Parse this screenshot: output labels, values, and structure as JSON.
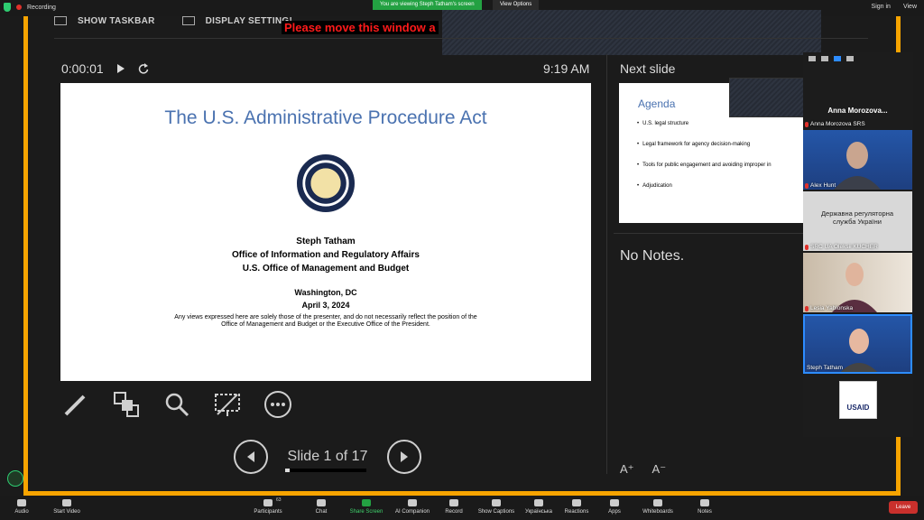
{
  "top_bar": {
    "recording": "Recording",
    "viewing": "You are viewing Steph Tatham's screen",
    "view_options": "View Options",
    "sign_in": "Sign in",
    "view": "View"
  },
  "presenter_toolbar": {
    "show_taskbar": "SHOW TASKBAR",
    "display_settings": "DISPLAY SETTING!",
    "warning": "Please move this window a"
  },
  "presenter_view": {
    "timer": "0:00:01",
    "clock": "9:19 AM",
    "next_slide_label": "Next slide",
    "notes": "No Notes.",
    "slide_counter": "Slide 1 of 17",
    "progress": 0.06
  },
  "slide": {
    "title": "The U.S. Administrative Procedure Act",
    "presenter": "Steph Tatham",
    "office": "Office of Information and Regulatory Affairs",
    "agency": "U.S. Office of Management and Budget",
    "city": "Washington, DC",
    "date": "April 3, 2024",
    "disclaimer": "Any views expressed here are solely those of the presenter, and do not necessarily reflect the position of the Office of Management and Budget or the Executive Office of the President."
  },
  "next_slide": {
    "title": "Agenda",
    "items": [
      "U.S. legal structure",
      "Legal framework for agency decision-making",
      "Tools for public engagement and avoiding improper in",
      "Adjudication"
    ]
  },
  "gallery": {
    "anna_big": "Anna  Morozova...",
    "tiles": [
      "Anna Morozova SRS",
      "Alex Hunt",
      "SRC UA Oleksii KUCHER",
      "Lesia Yablonska",
      "Steph Tatham"
    ],
    "ukr_sign": "Державна регуляторна служба України",
    "usaid": "USAID"
  },
  "bottom_bar": {
    "audio": "Audio",
    "video": "Start Video",
    "participants": "Participants",
    "participants_count": "63",
    "chat": "Chat",
    "share": "Share Screen",
    "ai": "AI Companion",
    "record": "Record",
    "captions": "Show Captions",
    "language": "Українська",
    "reactions": "Reactions",
    "apps": "Apps",
    "whiteboards": "Whiteboards",
    "notes": "Notes",
    "leave": "Leave"
  },
  "colors": {
    "accent_orange": "#f7a400",
    "zoom_green": "#23a142",
    "title_blue": "#4a72b0",
    "leave_red": "#c9302c"
  }
}
